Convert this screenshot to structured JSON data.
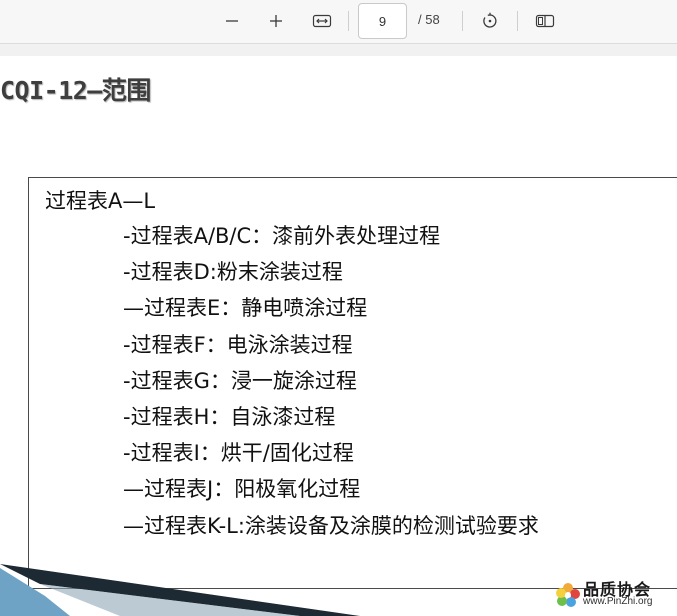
{
  "toolbar": {
    "zoom_out_icon": "minus-icon",
    "zoom_in_icon": "plus-icon",
    "fit_icon": "fit-width-icon",
    "page_current": "9",
    "page_total": "/ 58",
    "rotate_icon": "rotate-icon",
    "two_page_icon": "two-page-view-icon"
  },
  "slide": {
    "title": "CQI-12—范围",
    "heading": "过程表A—L",
    "items": [
      "-过程表A/B/C：漆前外表处理过程",
      "-过程表D:粉末涂装过程",
      "—过程表E：静电喷涂过程",
      "-过程表F：电泳涂装过程",
      "-过程表G：浸一旋涂过程",
      "-过程表H：自泳漆过程",
      "-过程表I：烘干/固化过程",
      "—过程表J：阳极氧化过程",
      "—过程表K-L:涂装设备及涂膜的检测试验要求"
    ]
  },
  "watermark": {
    "title": "品质协会",
    "url": "www.PinZhi.org"
  },
  "colors": {
    "toolbar_bg": "#f7f7f7",
    "title": "#3e3e3e",
    "text": "#111111",
    "swoosh_dark": "#1d2a33",
    "swoosh_blue": "#6fa3c6"
  }
}
